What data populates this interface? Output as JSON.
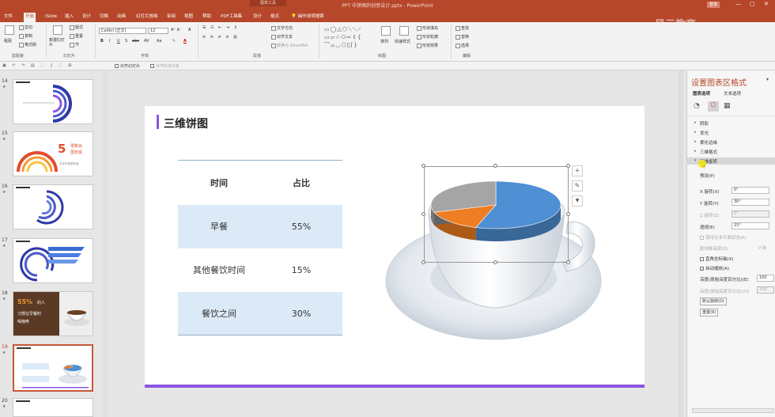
{
  "titlebar": {
    "context_tab": "图表工具",
    "title": "PPT 中饼图的创意设计.pptx  -  PowerPoint",
    "login": "登录",
    "min": "—",
    "max": "▢",
    "close": "✕"
  },
  "tabs": [
    "文件",
    "开始",
    "iSlide",
    "插入",
    "设计",
    "切换",
    "动画",
    "幻灯片放映",
    "审阅",
    "视图",
    "帮助",
    "PDF工具集",
    "设计",
    "格式"
  ],
  "tell_me": "操作说明搜索",
  "watermark": "风云教育",
  "ribbon": {
    "clipboard": {
      "label": "剪贴板",
      "paste": "粘贴",
      "cut": "剪切",
      "copy": "复制",
      "format_painter": "格式刷"
    },
    "slides": {
      "label": "幻灯片",
      "new_slide": "新建幻灯片",
      "layout": "版式",
      "reset": "重置",
      "section": "节"
    },
    "font": {
      "label": "字体",
      "name": "Calibri (正文)",
      "size": "12",
      "buttons": [
        "B",
        "I",
        "U",
        "S",
        "abc",
        "AV",
        "Aa",
        "A"
      ]
    },
    "paragraph": {
      "label": "段落",
      "text_direction": "文字方向",
      "align_text": "对齐文本",
      "smartart": "转换为 SmartArt"
    },
    "drawing": {
      "label": "绘图",
      "arrange": "排列",
      "quick_styles": "快速样式",
      "fill": "形状填充",
      "outline": "形状轮廓",
      "effects": "形状效果"
    },
    "editing": {
      "label": "编辑",
      "find": "查找",
      "replace": "替换",
      "select": "选择"
    }
  },
  "qat": {
    "align_slide": "对齐幻灯片",
    "align_items": "对齐所选对象"
  },
  "thumbnails": [
    {
      "num": "14",
      "star": "★"
    },
    {
      "num": "15",
      "star": "★",
      "big": "5",
      "line1": "零数会",
      "line2": "国年底",
      "footer": "五年来我国年度"
    },
    {
      "num": "16",
      "star": "★"
    },
    {
      "num": "17",
      "star": "★"
    },
    {
      "num": "18",
      "star": "★",
      "big": "55%",
      "line1": "的人",
      "line2": "习惯在早餐时",
      "line3": "喝咖啡"
    },
    {
      "num": "19",
      "star": "★"
    },
    {
      "num": "20",
      "star": "★"
    }
  ],
  "slide": {
    "title": "三维饼图",
    "table": {
      "headers": [
        "时间",
        "占比"
      ],
      "rows": [
        [
          "早餐",
          "55%"
        ],
        [
          "其他餐饮时间",
          "15%"
        ],
        [
          "餐饮之间",
          "30%"
        ]
      ]
    }
  },
  "chart_data": {
    "type": "pie",
    "categories": [
      "早餐",
      "其他餐饮时间",
      "餐饮之间"
    ],
    "values": [
      55,
      15,
      30
    ],
    "colors": [
      "#4f8fd3",
      "#ef7d22",
      "#a5a5a5"
    ],
    "style": "3d"
  },
  "chart_tools": {
    "add": "+",
    "style": "✎",
    "filter": "▼"
  },
  "pane": {
    "title": "设置图表区格式",
    "tab1": "图表选项",
    "tab2": "文本选项",
    "sections": [
      "阴影",
      "发光",
      "柔化边缘",
      "三维格式",
      "三维旋转"
    ],
    "preset": "预设(P)",
    "x_label": "X 旋转(X)",
    "x_value": "0°",
    "y_label": "Y 旋转(Y)",
    "y_value": "30°",
    "z_label": "Z 旋转(Z)",
    "z_value": "0°",
    "persp_label": "透视(E)",
    "persp_value": "15°",
    "keep_text_flat": "保持文本平面状态(K)",
    "distance_label": "距地面高度(D)",
    "distance_value": "0 磅",
    "right_angle": "直角坐标轴(X)",
    "autoscale": "自动缩放(A)",
    "depth_label": "深度(原始深度百分比)(E)",
    "depth_value": "100",
    "height_label": "高度(原始高度百分比)(H)",
    "height_value": "100",
    "default_rotation": "默认旋转(D)",
    "reset": "重置(R)"
  }
}
